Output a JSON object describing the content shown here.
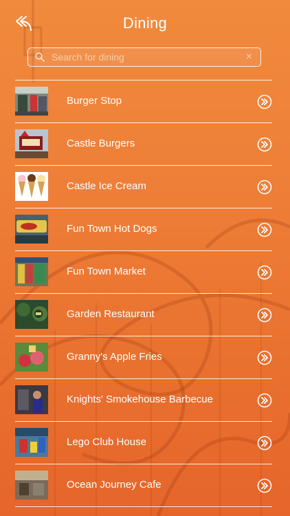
{
  "header": {
    "title": "Dining",
    "back_icon": "back-arrow-icon"
  },
  "search": {
    "placeholder": "Search for dining",
    "value": "",
    "clear_symbol": "×"
  },
  "colors": {
    "background_top": "#f08a3c",
    "background_bottom": "#e6652b",
    "text": "#ffffff"
  },
  "items": [
    {
      "label": "Burger Stop",
      "thumb": "burger-stop-photo"
    },
    {
      "label": "Castle Burgers",
      "thumb": "castle-burgers-photo"
    },
    {
      "label": "Castle Ice Cream",
      "thumb": "castle-ice-cream-photo"
    },
    {
      "label": "Fun Town Hot Dogs",
      "thumb": "fun-town-hot-dogs-photo"
    },
    {
      "label": "Fun Town Market",
      "thumb": "fun-town-market-photo"
    },
    {
      "label": "Garden Restaurant",
      "thumb": "garden-restaurant-photo"
    },
    {
      "label": "Granny's Apple Fries",
      "thumb": "grannys-apple-fries-photo"
    },
    {
      "label": "Knights' Smokehouse Barbecue",
      "thumb": "knights-smokehouse-photo"
    },
    {
      "label": "Lego Club House",
      "thumb": "lego-club-house-photo"
    },
    {
      "label": "Ocean Journey Cafe",
      "thumb": "ocean-journey-cafe-photo"
    }
  ]
}
